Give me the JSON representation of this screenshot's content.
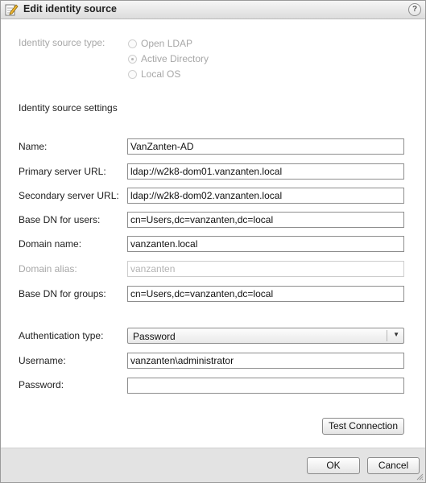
{
  "dialog": {
    "title": "Edit identity source",
    "help_glyph": "?"
  },
  "source_type": {
    "label": "Identity source type:",
    "options": [
      {
        "label": "Open LDAP",
        "checked": false
      },
      {
        "label": "Active Directory",
        "checked": true
      },
      {
        "label": "Local OS",
        "checked": false
      }
    ]
  },
  "settings": {
    "heading": "Identity source settings",
    "name": {
      "label": "Name:",
      "value": "VanZanten-AD"
    },
    "primary_url": {
      "label": "Primary server URL:",
      "value": "ldap://w2k8-dom01.vanzanten.local"
    },
    "secondary_url": {
      "label": "Secondary server URL:",
      "value": "ldap://w2k8-dom02.vanzanten.local"
    },
    "base_dn_users": {
      "label": "Base DN for users:",
      "value": "cn=Users,dc=vanzanten,dc=local"
    },
    "domain_name": {
      "label": "Domain name:",
      "value": "vanzanten.local"
    },
    "domain_alias": {
      "label": "Domain alias:",
      "value": "vanzanten"
    },
    "base_dn_groups": {
      "label": "Base DN for groups:",
      "value": "cn=Users,dc=vanzanten,dc=local"
    }
  },
  "auth": {
    "type_label": "Authentication type:",
    "type_value": "Password",
    "username_label": "Username:",
    "username_value": "vanzanten\\administrator",
    "password_label": "Password:",
    "password_value": ""
  },
  "buttons": {
    "test_connection": "Test Connection",
    "ok": "OK",
    "cancel": "Cancel"
  }
}
